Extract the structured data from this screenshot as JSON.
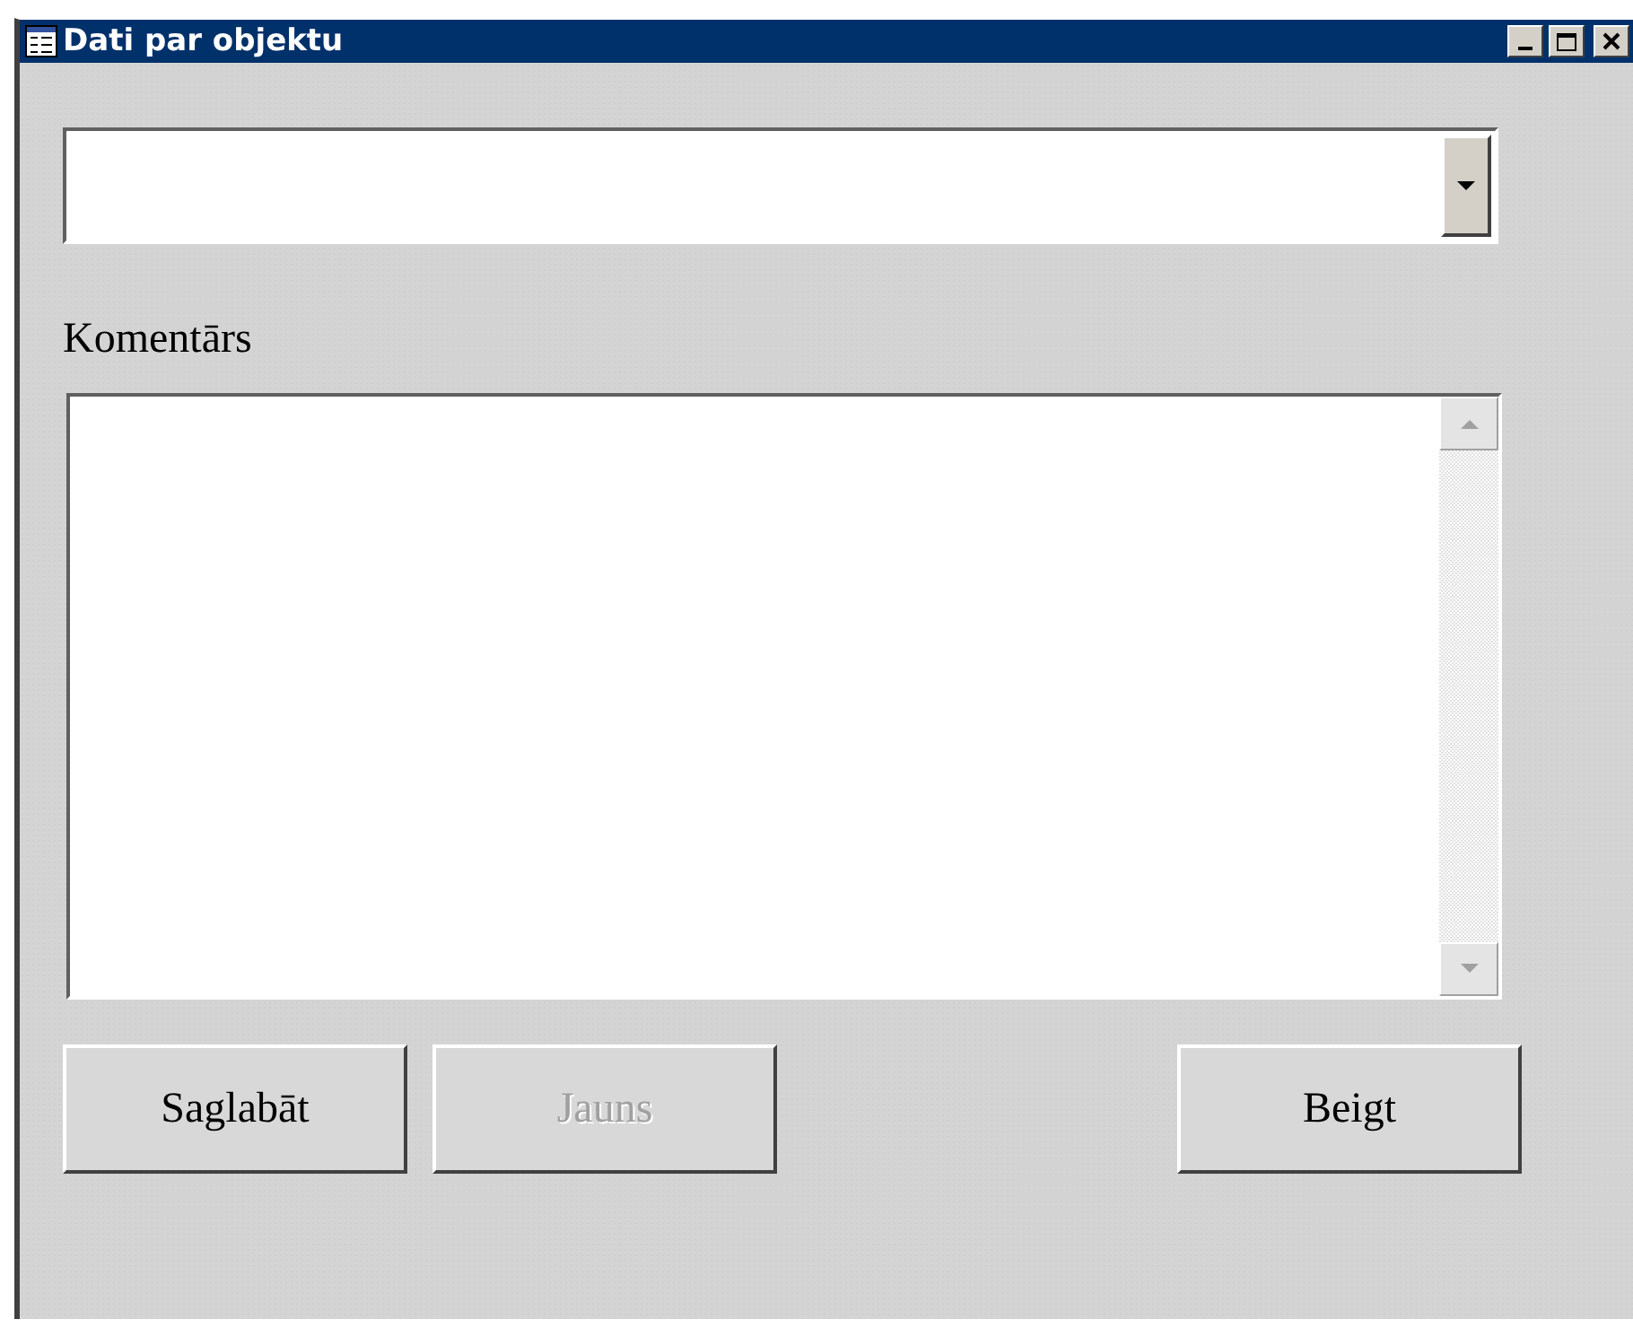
{
  "window": {
    "title": "Dati par objektu"
  },
  "comment": {
    "label": "Komentārs"
  },
  "buttons": [
    {
      "label": "Saglabāt",
      "disabled": false
    },
    {
      "label": "Jauns",
      "disabled": true
    },
    {
      "label": "Beigt",
      "disabled": false
    }
  ]
}
